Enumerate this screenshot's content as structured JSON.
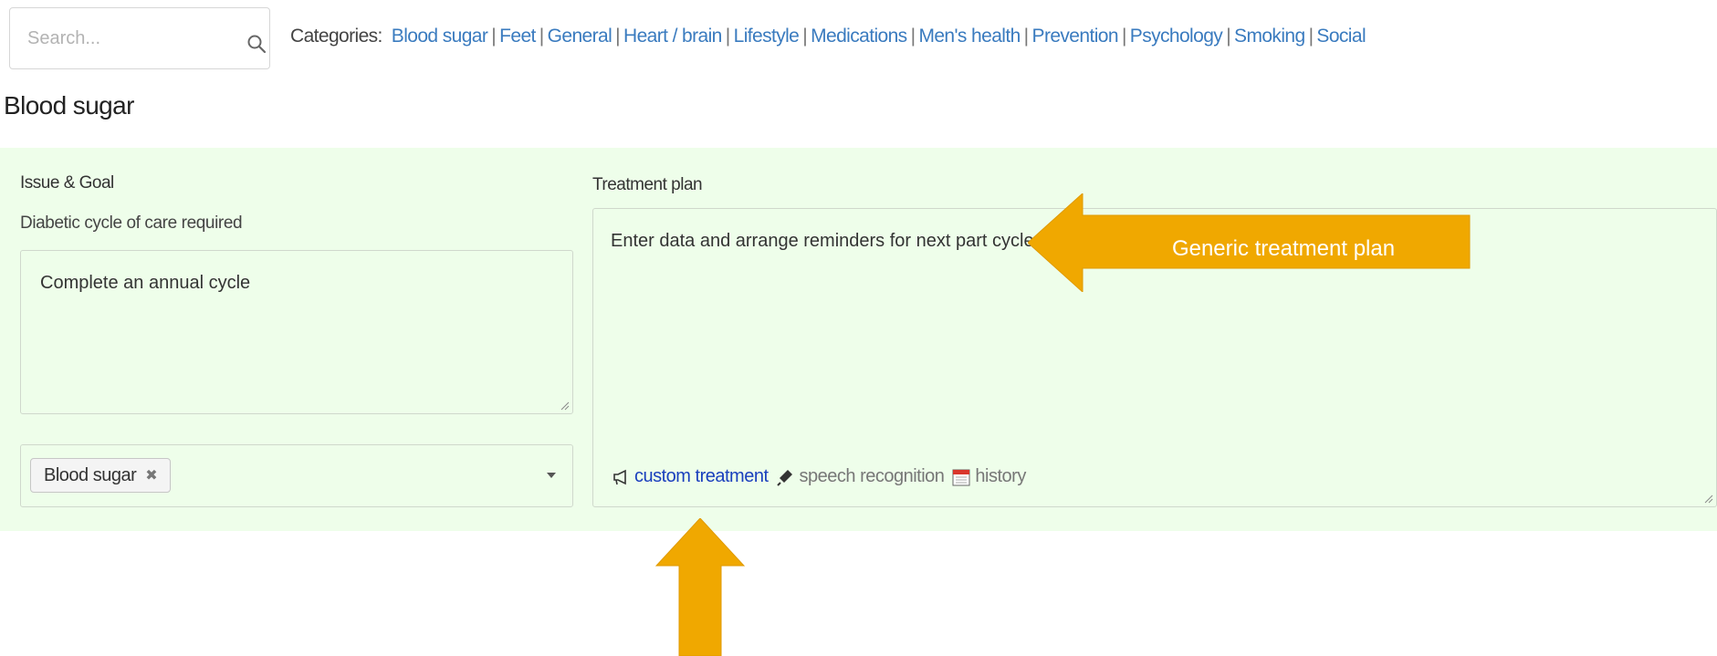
{
  "search": {
    "placeholder": "Search..."
  },
  "categories": {
    "label": "Categories:",
    "items": [
      "Blood sugar",
      "Feet",
      "General",
      "Heart / brain",
      "Lifestyle",
      "Medications",
      "Men's health",
      "Prevention",
      "Psychology",
      "Smoking",
      "Social"
    ],
    "link_color": "#3a7bbf"
  },
  "section": {
    "title": "Blood sugar"
  },
  "panel": {
    "background": "#eefeea",
    "issue_label": "Issue & Goal",
    "issue_text": "Diabetic cycle of care required",
    "goal_text": "Complete an annual cycle",
    "selected_category": "Blood sugar",
    "plan_label": "Treatment plan",
    "plan_text": "Enter data and arrange reminders for next part cycle.",
    "links": {
      "custom": "custom treatment",
      "speech": "speech recognition",
      "history": "history"
    }
  },
  "annotations": {
    "arrow_color": "#f0a800",
    "callout_text": "Generic treatment plan"
  }
}
